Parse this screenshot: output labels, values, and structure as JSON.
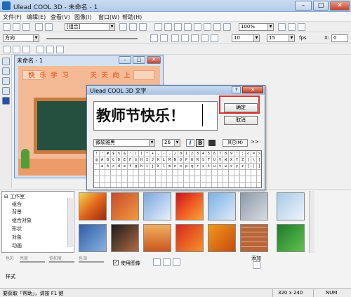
{
  "window": {
    "title": "Ulead COOL 3D - 未命名 - 1",
    "min": "–",
    "max": "□",
    "close": "✕"
  },
  "menu": [
    "文件(F)",
    "编辑(E)",
    "查看(V)",
    "图像(I)",
    "窗口(W)",
    "帮助(H)"
  ],
  "toolbar1": {
    "object_combo": "[组合]",
    "zoom_combo": "100%"
  },
  "toolbar2": {
    "direction_combo": "方向",
    "field_10": "10",
    "field_15": "15",
    "fps_label": "fps",
    "x_label": "X:",
    "x_value": "0"
  },
  "document": {
    "title": "未命名 - 1",
    "banner_left": [
      "快",
      "乐",
      "学",
      "习"
    ],
    "banner_right": [
      "天",
      "天",
      "向",
      "上"
    ]
  },
  "dialog": {
    "title": "Ulead COOL 3D 文字",
    "help": "?",
    "close": "✕",
    "text_value": "教师节快乐！",
    "ok_label": "确定",
    "cancel_label": "取消",
    "font_name": "微软雅黑",
    "font_size": "26",
    "italic": "I",
    "bold": "B",
    "other_label": "其它(M)",
    "more_label": ">>",
    "charmap_rows": [
      [
        "!",
        "\"",
        "#",
        "$",
        "%",
        "&",
        "'",
        "(",
        ")",
        "*",
        "+",
        ",",
        "-",
        ".",
        "/",
        "0",
        "1",
        "2",
        "3",
        "4",
        "5",
        "6",
        "7",
        "8",
        "9",
        ":",
        ";",
        "<",
        "=",
        ">"
      ],
      [
        "@",
        "A",
        "B",
        "C",
        "D",
        "E",
        "F",
        "G",
        "H",
        "I",
        "J",
        "K",
        "L",
        "M",
        "N",
        "O",
        "P",
        "Q",
        "R",
        "S",
        "T",
        "U",
        "V",
        "W",
        "X",
        "Y",
        "Z",
        "[",
        "\\",
        "]"
      ],
      [
        "`",
        "a",
        "b",
        "c",
        "d",
        "e",
        "f",
        "g",
        "h",
        "i",
        "j",
        "k",
        "l",
        "m",
        "n",
        "o",
        "p",
        "q",
        "r",
        "s",
        "t",
        "u",
        "v",
        "w",
        "x",
        "y",
        "z",
        "{",
        "|",
        "}"
      ]
    ]
  },
  "tree": {
    "root": "工作室",
    "items": [
      "组合",
      "背景",
      "组合对象",
      "形状",
      "对象",
      "动画"
    ]
  },
  "bottom": {
    "slider_labels": [
      "色彩",
      "亮度",
      "饱和度",
      "色调"
    ],
    "use_image_label": "使用图像",
    "add_label": "添加",
    "style_label": "样式"
  },
  "status": {
    "hint": "要获取「帮助」，请按 F1 键",
    "size": "320 x 240",
    "num": "NUM"
  },
  "colors": {
    "title_bar": "#b9cfea",
    "canvas_wall": "#f4b995",
    "board": "#25503f",
    "highlight": "#e03434"
  }
}
